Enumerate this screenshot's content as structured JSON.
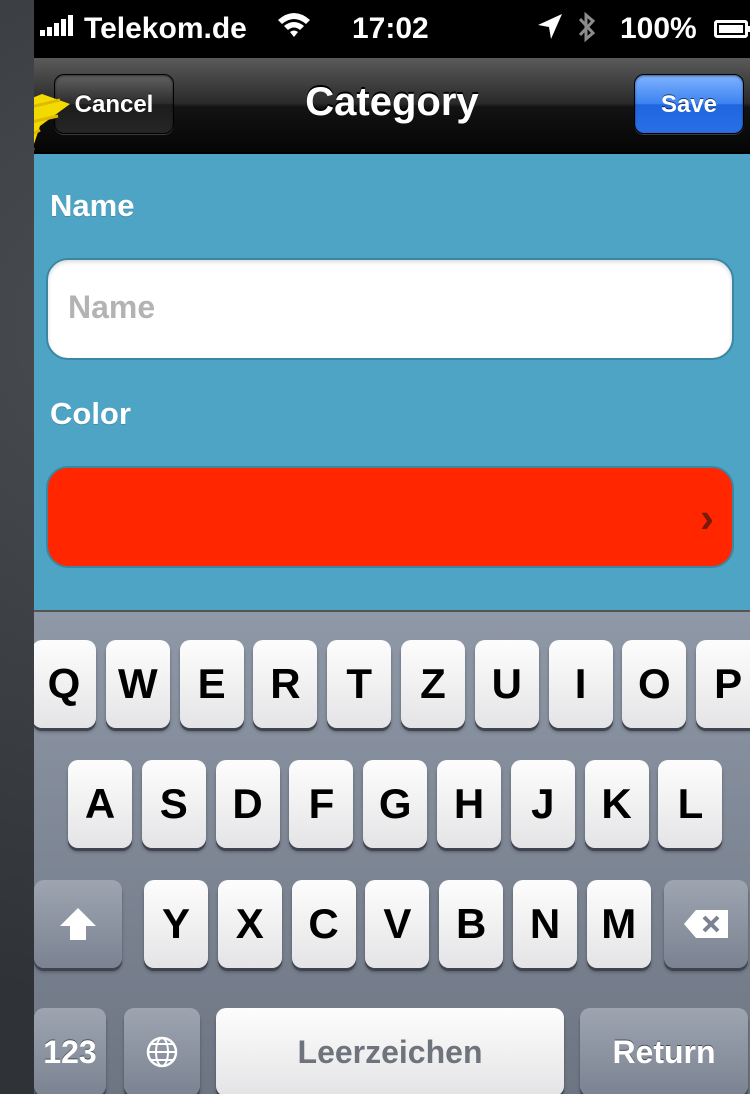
{
  "status_bar": {
    "carrier": "Telekom.de",
    "time": "17:02",
    "battery": "100%",
    "wifi_icon": "wifi-icon",
    "location_icon": "location-arrow-icon",
    "bluetooth_icon": "bluetooth-icon"
  },
  "nav": {
    "title": "Category",
    "cancel_label": "Cancel",
    "save_label": "Save"
  },
  "form": {
    "name_label": "Name",
    "name_placeholder": "Name",
    "name_value": "",
    "color_label": "Color",
    "color_value": "#ff2600"
  },
  "keyboard": {
    "row1": [
      "Q",
      "W",
      "E",
      "R",
      "T",
      "Z",
      "U",
      "I",
      "O",
      "P"
    ],
    "row2": [
      "A",
      "S",
      "D",
      "F",
      "G",
      "H",
      "J",
      "K",
      "L"
    ],
    "row3": [
      "Y",
      "X",
      "C",
      "V",
      "B",
      "N",
      "M"
    ],
    "numbers_label": "123",
    "space_label": "Leerzeichen",
    "return_label": "Return"
  },
  "colors": {
    "content_bg": "#4ea4c4",
    "save_button": "#2a6fe6",
    "highlighter": "#ffe600"
  }
}
